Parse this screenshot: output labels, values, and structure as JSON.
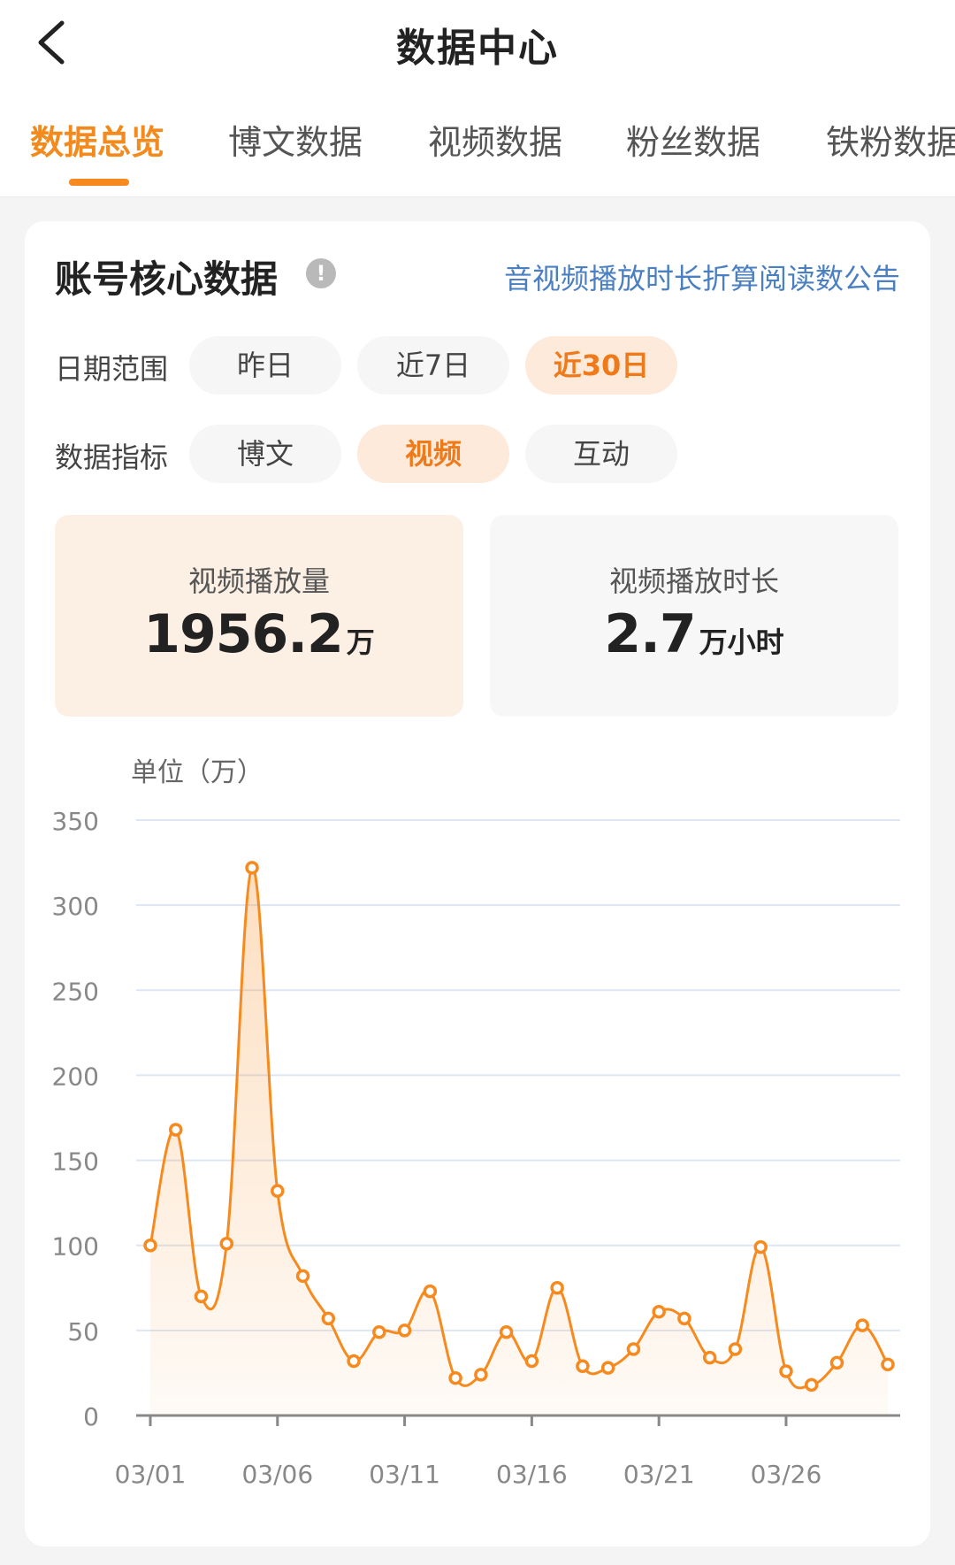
{
  "header": {
    "title": "数据中心",
    "tabs": [
      {
        "label": "数据总览",
        "active": true
      },
      {
        "label": "博文数据",
        "active": false
      },
      {
        "label": "视频数据",
        "active": false
      },
      {
        "label": "粉丝数据",
        "active": false
      },
      {
        "label": "铁粉数据",
        "active": false
      }
    ]
  },
  "card": {
    "title": "账号核心数据",
    "notice_link": "音视频播放时长折算阅读数公告",
    "date_range": {
      "label": "日期范围",
      "options": [
        "昨日",
        "近7日",
        "近30日"
      ],
      "selected": "近30日"
    },
    "metric": {
      "label": "数据指标",
      "options": [
        "博文",
        "视频",
        "互动"
      ],
      "selected": "视频"
    },
    "stats": [
      {
        "label": "视频播放量",
        "value": "1956.2",
        "unit": "万",
        "active": true
      },
      {
        "label": "视频播放时长",
        "value": "2.7",
        "unit": "万小时",
        "active": false
      }
    ],
    "unit_label": "单位（万）"
  },
  "colors": {
    "accent": "#f68a1f",
    "link": "#4a7fc1"
  },
  "chart_data": {
    "type": "area",
    "x": [
      "03/01",
      "03/02",
      "03/03",
      "03/04",
      "03/05",
      "03/06",
      "03/07",
      "03/08",
      "03/09",
      "03/10",
      "03/11",
      "03/12",
      "03/13",
      "03/14",
      "03/15",
      "03/16",
      "03/17",
      "03/18",
      "03/19",
      "03/20",
      "03/21",
      "03/22",
      "03/23",
      "03/24",
      "03/25",
      "03/26",
      "03/27",
      "03/28",
      "03/29",
      "03/30"
    ],
    "values": [
      100,
      168,
      70,
      101,
      322,
      132,
      82,
      57,
      32,
      49,
      50,
      73,
      22,
      24,
      49,
      32,
      75,
      29,
      28,
      39,
      61,
      57,
      34,
      39,
      99,
      26,
      18,
      31,
      53,
      30
    ],
    "x_tick_labels": [
      "03/01",
      "03/06",
      "03/11",
      "03/16",
      "03/21",
      "03/26"
    ],
    "y_ticks": [
      0,
      50,
      100,
      150,
      200,
      250,
      300,
      350
    ],
    "ylim": [
      0,
      350
    ],
    "ylabel": "单位（万）",
    "grid": true
  }
}
